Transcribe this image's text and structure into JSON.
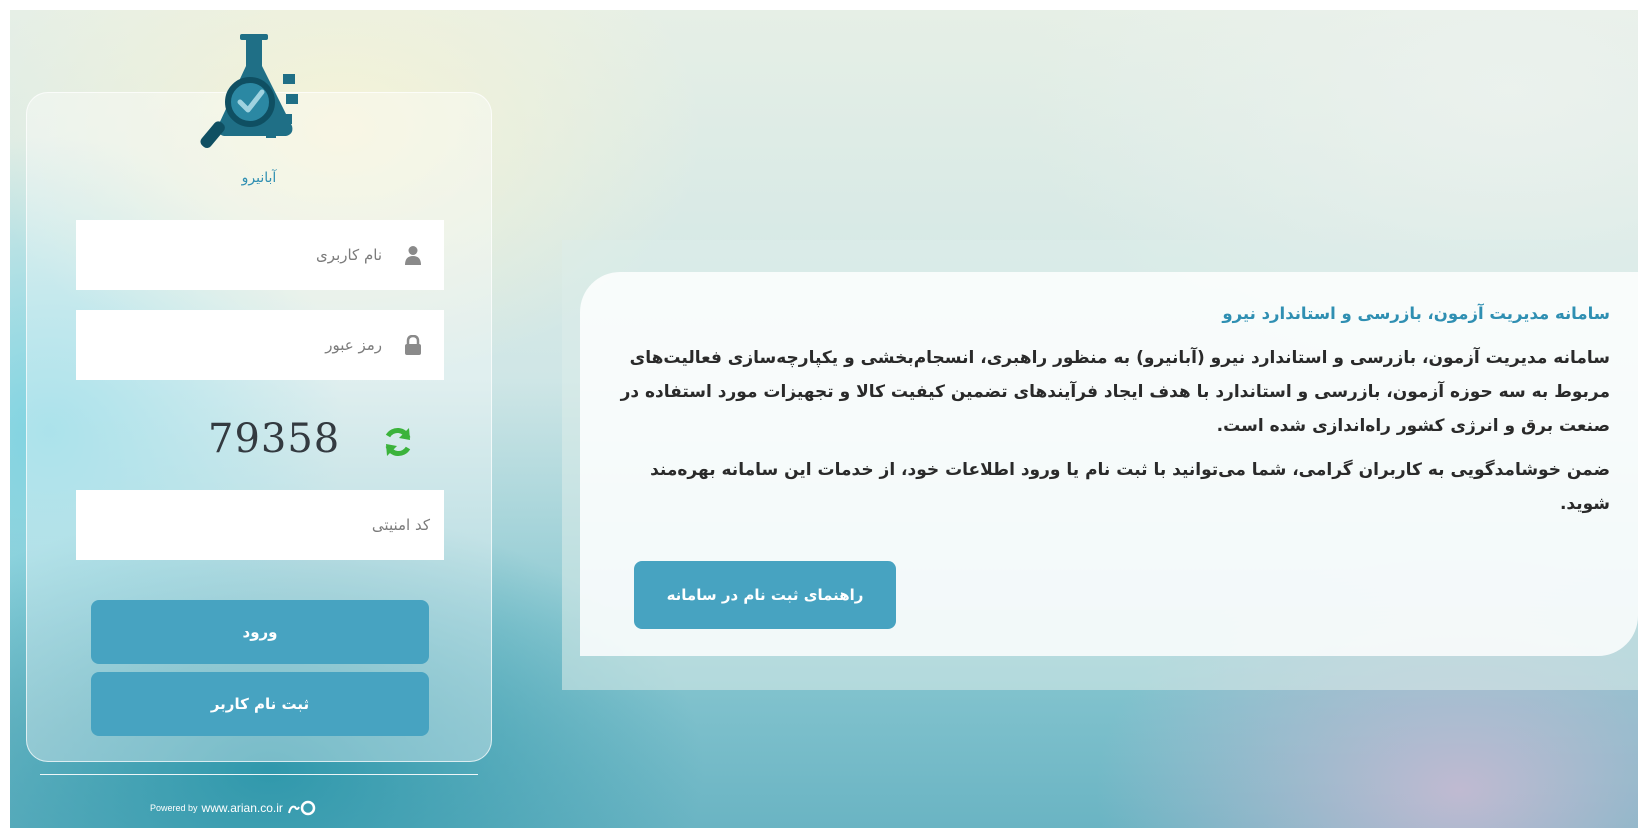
{
  "login": {
    "logo_caption": "آبانیرو",
    "username_placeholder": "نام کاربری",
    "password_placeholder": "رمز عبور",
    "captcha_code": "79358",
    "security_code_placeholder": "کد امنیتی",
    "login_button": "ورود",
    "register_button": "ثبت نام کاربر"
  },
  "footer": {
    "powered_by": "Powered by",
    "website": "www.arian.co.ir"
  },
  "info": {
    "title": "سامانه مدیریت آزمون، بازرسی و استاندارد نیرو",
    "paragraph1": "سامانه مدیریت آزمون، بازرسی و استاندارد نیرو (آبانیرو) به منظور راهبری، انسجام‌بخشی و یکپارچه‌سازی فعالیت‌های مربوط به سه حوزه آزمون، بازرسی و استاندارد با هدف ایجاد فرآیندهای تضمین کیفیت کالا و تجهیزات مورد استفاده در صنعت برق و انرژی کشور راه‌اندازی شده است.",
    "paragraph2": "ضمن خوشامدگویی به کاربران گرامی، شما می‌توانید با ثبت نام یا ورود اطلاعات خود، از خدمات این سامانه بهره‌مند شوید.",
    "guide_button": "راهنمای ثبت نام در سامانه"
  },
  "icons": {
    "logo": "flask-gear-magnifier-logo",
    "username": "user-icon",
    "password": "lock-icon",
    "refresh": "refresh-icon",
    "brand": "arian-logo"
  },
  "colors": {
    "accent": "#47a3c1",
    "title_blue": "#2f8fb2",
    "refresh_green": "#3bb33b",
    "logo_teal": "#1f6f86"
  }
}
